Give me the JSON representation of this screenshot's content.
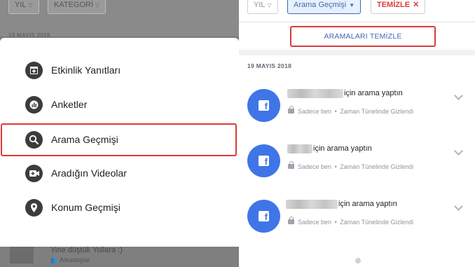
{
  "left": {
    "filters": {
      "year": "YIL",
      "category": "KATEGORİ"
    },
    "date_faded": "19 MAYIS 2018",
    "menu": [
      {
        "label": "Etkinlik Yanıtları",
        "icon": "calendar-plus-icon"
      },
      {
        "label": "Anketler",
        "icon": "poll-chart-icon"
      },
      {
        "label": "Arama Geçmişi",
        "icon": "search-icon",
        "highlighted": true
      },
      {
        "label": "Aradığın Videolar",
        "icon": "video-plus-icon"
      },
      {
        "label": "Konum Geçmişi",
        "icon": "location-pin-icon"
      }
    ],
    "behind_post": {
      "text": "Yine düştük Yollara :)",
      "audience": "Arkadaşlar"
    }
  },
  "right": {
    "filters": {
      "year": "YIL",
      "active": "Arama Geçmişi",
      "clear": "TEMİZLE"
    },
    "clear_all": "ARAMALARI TEMİZLE",
    "date": "19 MAYIS 2018",
    "entries": [
      {
        "title": "için arama yaptın",
        "privacy": "Sadece ben",
        "status": "Zaman Tünelinde Gizlendi"
      },
      {
        "title": "için arama yaptın",
        "privacy": "Sadece ben",
        "status": "Zaman Tünelinde Gizlendi"
      },
      {
        "title": "için arama yaptın",
        "privacy": "Sadece ben",
        "status": "Zaman Tünelinde Gizlendi"
      }
    ],
    "separator": "•"
  },
  "colors": {
    "accent": "#4267b2",
    "facebook_blue": "#3f75e7",
    "highlight_red": "#d93b3b"
  }
}
